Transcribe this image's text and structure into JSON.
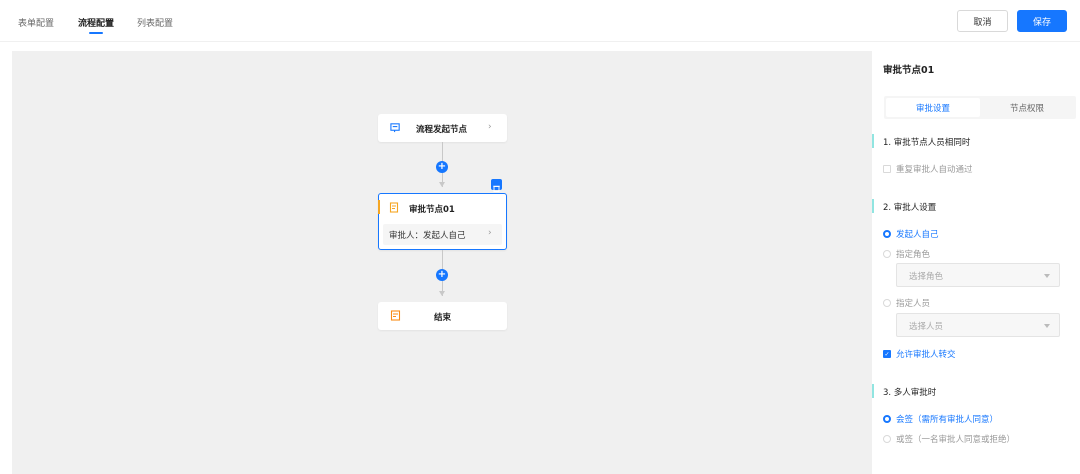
{
  "tabs": [
    {
      "label": "表单配置",
      "active": false
    },
    {
      "label": "流程配置",
      "active": true
    },
    {
      "label": "列表配置",
      "active": false
    }
  ],
  "actions": {
    "cancel": "取消",
    "save": "保存"
  },
  "flow": {
    "start_node": {
      "title": "流程发起节点"
    },
    "approve_node": {
      "title": "审批节点01",
      "approver": "审批人：发起人自己"
    },
    "end_node": {
      "title": "结束"
    }
  },
  "panel": {
    "title": "审批节点01",
    "tabs": [
      "审批设置",
      "节点权限"
    ],
    "section1": {
      "title": "1. 审批节点人员相同时",
      "option": "重复审批人自动通过"
    },
    "section2": {
      "title": "2. 审批人设置",
      "options": [
        "发起人自己",
        "指定角色",
        "指定人员"
      ],
      "role_placeholder": "选择角色",
      "person_placeholder": "选择人员",
      "transfer": "允许审批人转交"
    },
    "section3": {
      "title": "3. 多人审批时",
      "options": [
        "会签（需所有审批人同意）",
        "或签（一名审批人同意或拒绝）"
      ]
    }
  },
  "colors": {
    "accent": "#1677ff",
    "node_warn": "#f5a623",
    "end_icon": "#fa8c16"
  }
}
